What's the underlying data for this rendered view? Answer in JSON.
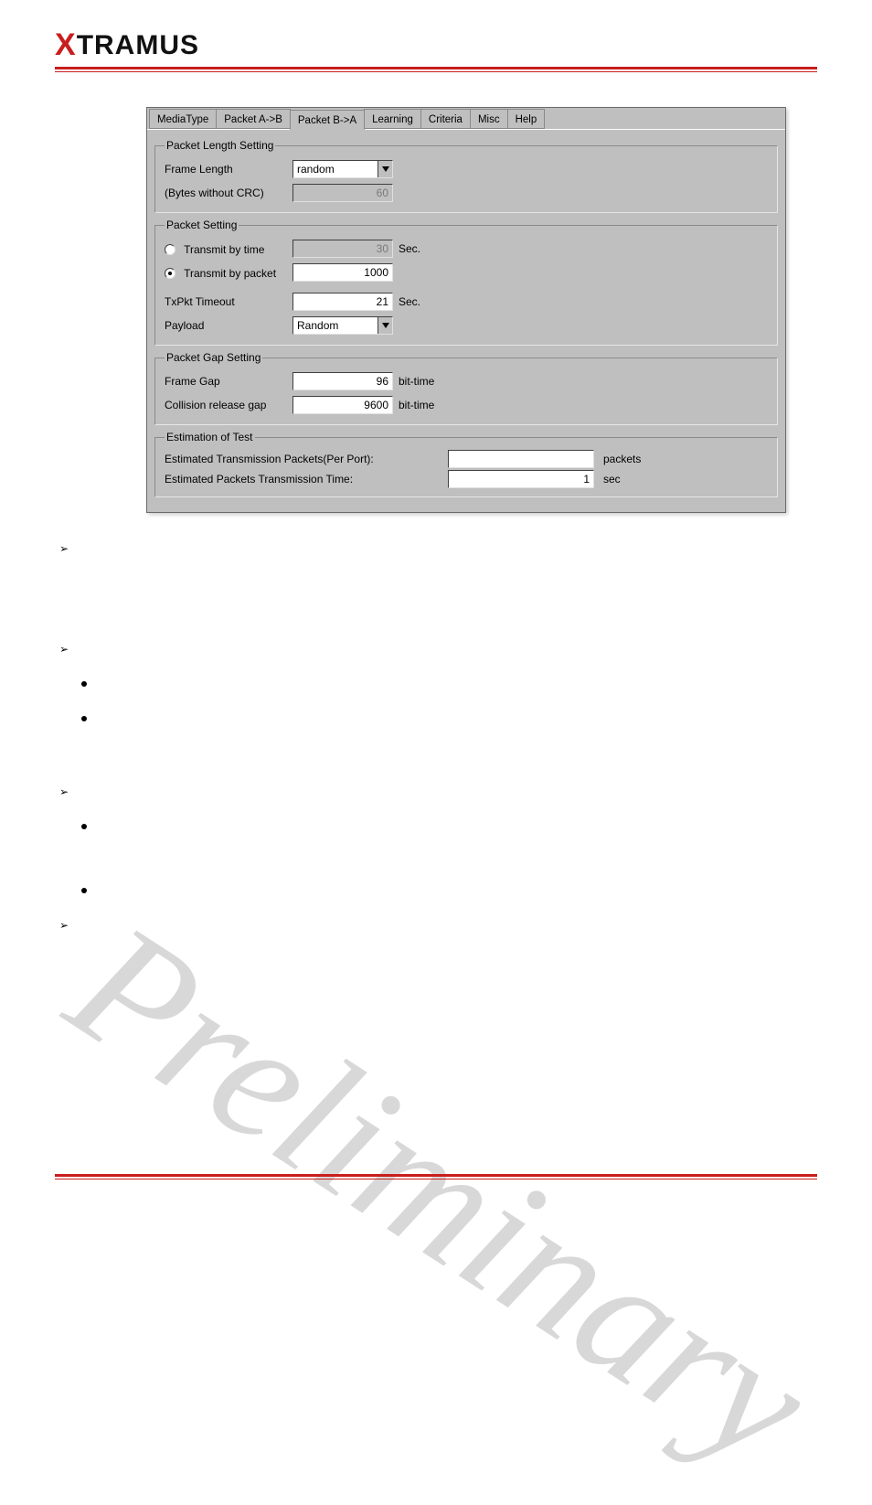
{
  "logo": {
    "x": "X",
    "rest": "TRAMUS"
  },
  "tabs": {
    "mediaType": "MediaType",
    "packetAB": "Packet A->B",
    "packetBA": "Packet B->A",
    "learning": "Learning",
    "criteria": "Criteria",
    "misc": "Misc",
    "help": "Help"
  },
  "groups": {
    "packetLengthSetting": {
      "legend": "Packet Length Setting",
      "frameLengthLabel": "Frame Length",
      "frameLengthValue": "random",
      "bytesLabel": "(Bytes without CRC)",
      "bytesValue": "60"
    },
    "packetSetting": {
      "legend": "Packet Setting",
      "transmitByTimeLabel": "Transmit by time",
      "transmitByTimeValue": "30",
      "transmitByTimeUnit": "Sec.",
      "transmitByPacketLabel": "Transmit by packet",
      "transmitByPacketValue": "1000",
      "txpktTimeoutLabel": "TxPkt Timeout",
      "txpktTimeoutValue": "21",
      "txpktTimeoutUnit": "Sec.",
      "payloadLabel": "Payload",
      "payloadValue": "Random"
    },
    "packetGapSetting": {
      "legend": "Packet Gap Setting",
      "frameGapLabel": "Frame Gap",
      "frameGapValue": "96",
      "frameGapUnit": "bit-time",
      "collisionLabel": "Collision release gap",
      "collisionValue": "9600",
      "collisionUnit": "bit-time"
    },
    "estimation": {
      "legend": "Estimation of Test",
      "etpLabel": "Estimated Transmission Packets(Per Port):",
      "etpValue": "",
      "etpUnit": "packets",
      "epttLabel": "Estimated Packets Transmission Time:",
      "epttValue": "1",
      "epttUnit": "sec"
    }
  },
  "watermark": "Preliminary"
}
